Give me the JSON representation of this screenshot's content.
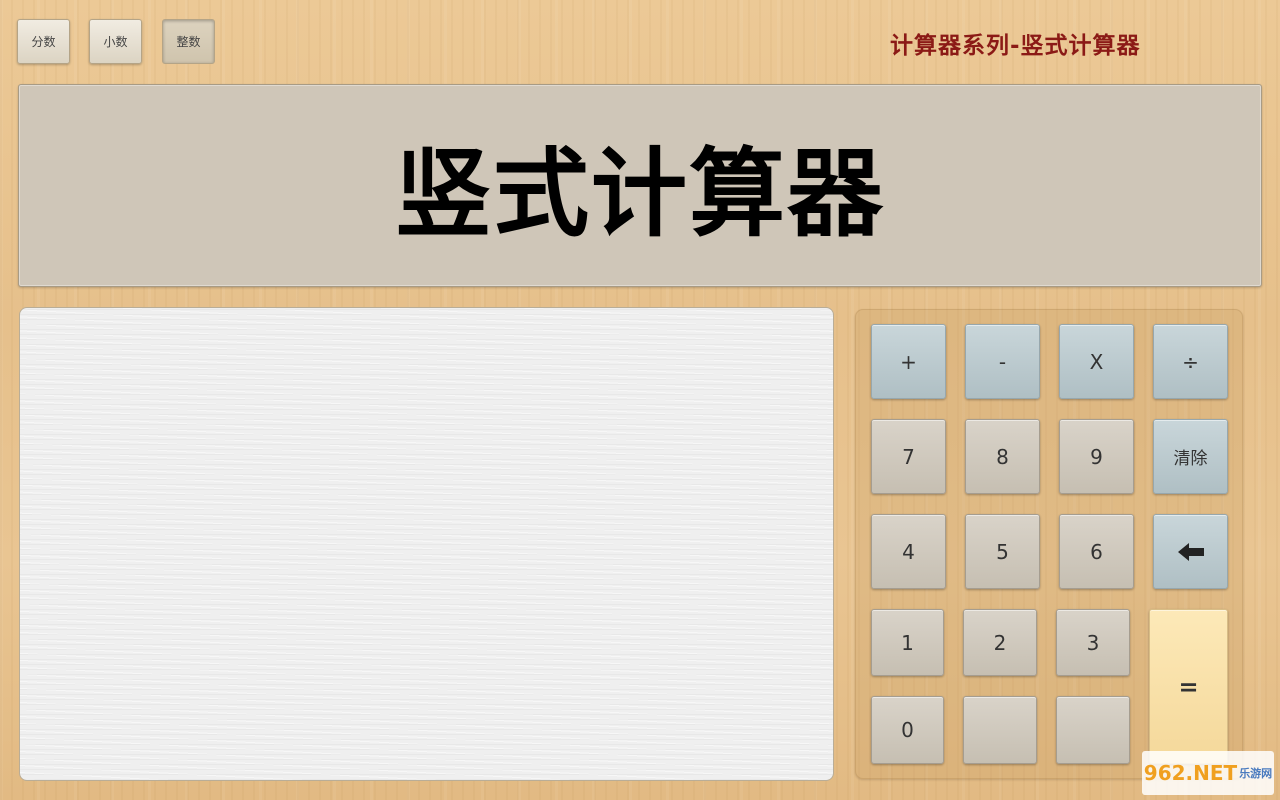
{
  "modes": [
    {
      "label": "分数"
    },
    {
      "label": "小数"
    },
    {
      "label": "整数"
    }
  ],
  "app_title": "计算器系列-竖式计算器",
  "display": {
    "text": "竖式计算器"
  },
  "keys": {
    "plus": "+",
    "minus": "-",
    "multiply": "X",
    "divide": "÷",
    "seven": "7",
    "eight": "8",
    "nine": "9",
    "clear": "清除",
    "four": "4",
    "five": "5",
    "six": "6",
    "one": "1",
    "two": "2",
    "three": "3",
    "zero": "0",
    "equals": "="
  },
  "watermark": {
    "main": "962.NET",
    "sub": "乐游网"
  },
  "colors": {
    "title": "#8b1a16",
    "operator_key": "#b8c8cc",
    "equals_key": "#f9e0a5"
  }
}
